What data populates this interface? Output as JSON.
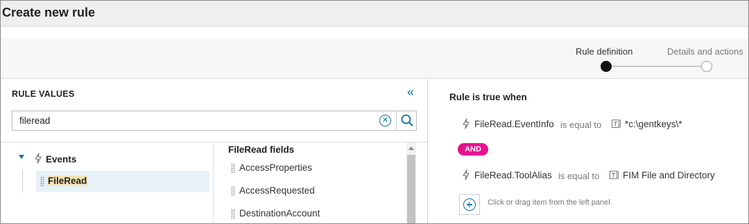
{
  "page": {
    "title": "Create new rule"
  },
  "wizard": {
    "steps": [
      {
        "label": "Rule definition",
        "state": "active"
      },
      {
        "label": "Details and actions",
        "state": "pending"
      }
    ]
  },
  "left_panel": {
    "header": "RULE VALUES",
    "collapse_icon": "double-chevron-left-icon",
    "search": {
      "value": "fileread",
      "placeholder": ""
    },
    "tree": {
      "group_label": "Events",
      "items": [
        {
          "label": "FileRead",
          "selected": true
        }
      ]
    },
    "fields": {
      "header": "FileRead fields",
      "items": [
        {
          "label": "AccessProperties"
        },
        {
          "label": "AccessRequested"
        },
        {
          "label": "DestinationAccount"
        }
      ]
    }
  },
  "right_panel": {
    "title": "Rule is true when",
    "conditions": [
      {
        "field": "FileRead.EventInfo",
        "operator": "is equal to",
        "value": "*c:\\gentkeys\\*"
      },
      {
        "field": "FileRead.ToolAlias",
        "operator": "is equal to",
        "value": "FIM File and Directory"
      }
    ],
    "connector": "AND",
    "add_hint": "Click or drag item from the left panel."
  },
  "colors": {
    "accent": "#0b6fa4",
    "and_badge": "#e8108f",
    "selected_row": "#e6f2f7",
    "search_highlight": "#f5e3b5"
  }
}
